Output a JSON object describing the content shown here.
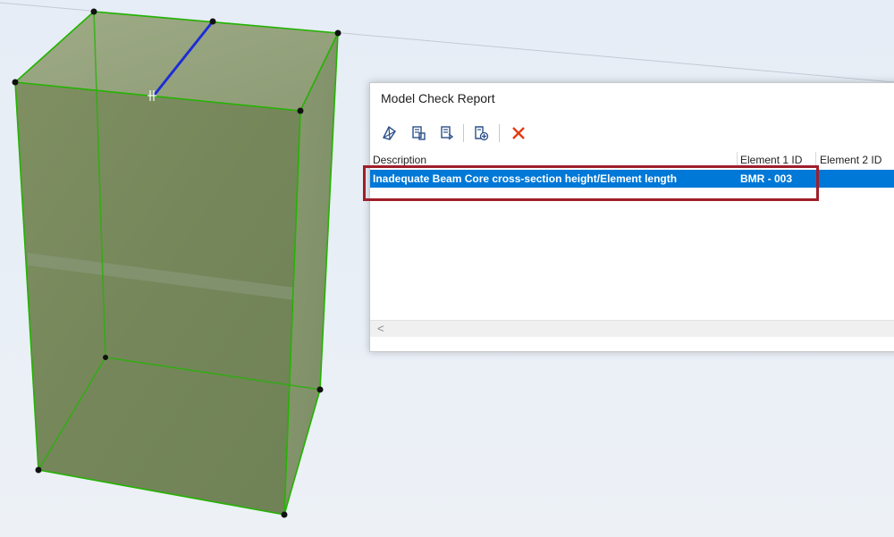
{
  "dialog": {
    "title": "Model Check Report",
    "toolbar": [
      {
        "icon": "select-elements-icon"
      },
      {
        "icon": "zoom-to-element-icon"
      },
      {
        "icon": "show-element-icon"
      },
      {
        "icon": "add-to-selection-icon"
      },
      {
        "icon": "delete-icon"
      }
    ],
    "columns": [
      "Description",
      "Element 1 ID",
      "Element 2 ID"
    ],
    "rows": [
      {
        "description": "Inadequate Beam Core cross-section height/Element length",
        "element1": "BMR - 003",
        "element2": ""
      }
    ],
    "scroll_left_glyph": "<"
  },
  "colors": {
    "selection": "#0078d7",
    "highlight": "#a01e2a",
    "edge": "#22b400",
    "beam": "#1c2dd6"
  }
}
